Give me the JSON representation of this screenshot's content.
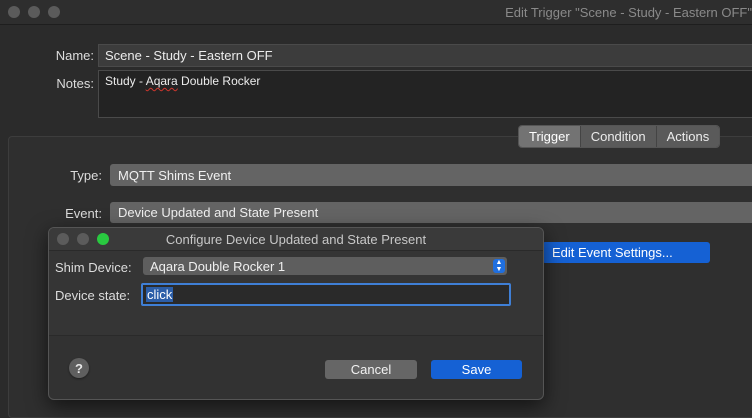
{
  "window": {
    "title": "Edit Trigger \"Scene - Study - Eastern OFF\""
  },
  "form": {
    "name_label": "Name:",
    "name_value": "Scene - Study - Eastern OFF",
    "notes_label": "Notes:",
    "notes_prefix": "Study - ",
    "notes_misspelled": "Aqara",
    "notes_suffix": " Double Rocker"
  },
  "tabs": [
    {
      "label": "Trigger",
      "selected": true
    },
    {
      "label": "Condition",
      "selected": false
    },
    {
      "label": "Actions",
      "selected": false
    }
  ],
  "trigger": {
    "type_label": "Type:",
    "type_value": "MQTT Shims Event",
    "event_label": "Event:",
    "event_value": "Device Updated and State Present",
    "edit_settings_label": "Edit Event Settings..."
  },
  "dialog": {
    "title": "Configure Device Updated and State Present",
    "shim_device_label": "Shim Device:",
    "shim_device_value": "Aqara Double Rocker 1",
    "device_state_label": "Device state:",
    "device_state_value": "click",
    "help_label": "?",
    "cancel_label": "Cancel",
    "save_label": "Save"
  },
  "colors": {
    "accent": "#1561d4",
    "close_light_dialog": "#5b5b5b",
    "zoom_light_dialog": "#29c940"
  },
  "icons": {
    "stepper": "stepper-arrows-icon",
    "help": "help-icon"
  }
}
